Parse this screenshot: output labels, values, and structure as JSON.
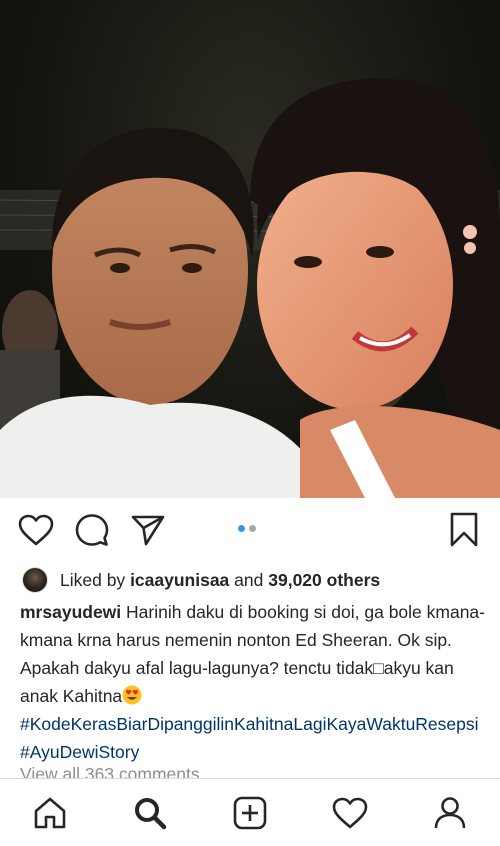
{
  "post": {
    "likes": {
      "prefix": "Liked by",
      "user": "icaayunisaa",
      "joiner": "and",
      "count": "39,020 others"
    },
    "caption": {
      "username": "mrsayudewi",
      "text": "Harinih daku di booking si doi, ga bole kmana-kmana krna harus nemenin nonton Ed Sheeran. Ok sip. Apakah dakyu afal lagu-lagunya? tenctu tidak□akyu kan anak Kahitna",
      "hashtags": [
        "#KodeKerasBiarDipanggilinKahitnaLagiKayaWaktuResepsi",
        "#AyuDewiStory"
      ]
    },
    "view_comments": "View all 363 comments",
    "carousel": {
      "count": 2,
      "active_index": 0
    }
  },
  "colors": {
    "accent": "#3897f0",
    "hashtag": "#003569",
    "muted": "#8e8e8e",
    "text": "#262626"
  },
  "icons": {
    "like": "heart-outline-icon",
    "comment": "comment-bubble-icon",
    "share": "paper-plane-icon",
    "save": "bookmark-icon",
    "nav": [
      "home-icon",
      "search-icon",
      "add-post-icon",
      "activity-heart-icon",
      "profile-icon"
    ]
  }
}
